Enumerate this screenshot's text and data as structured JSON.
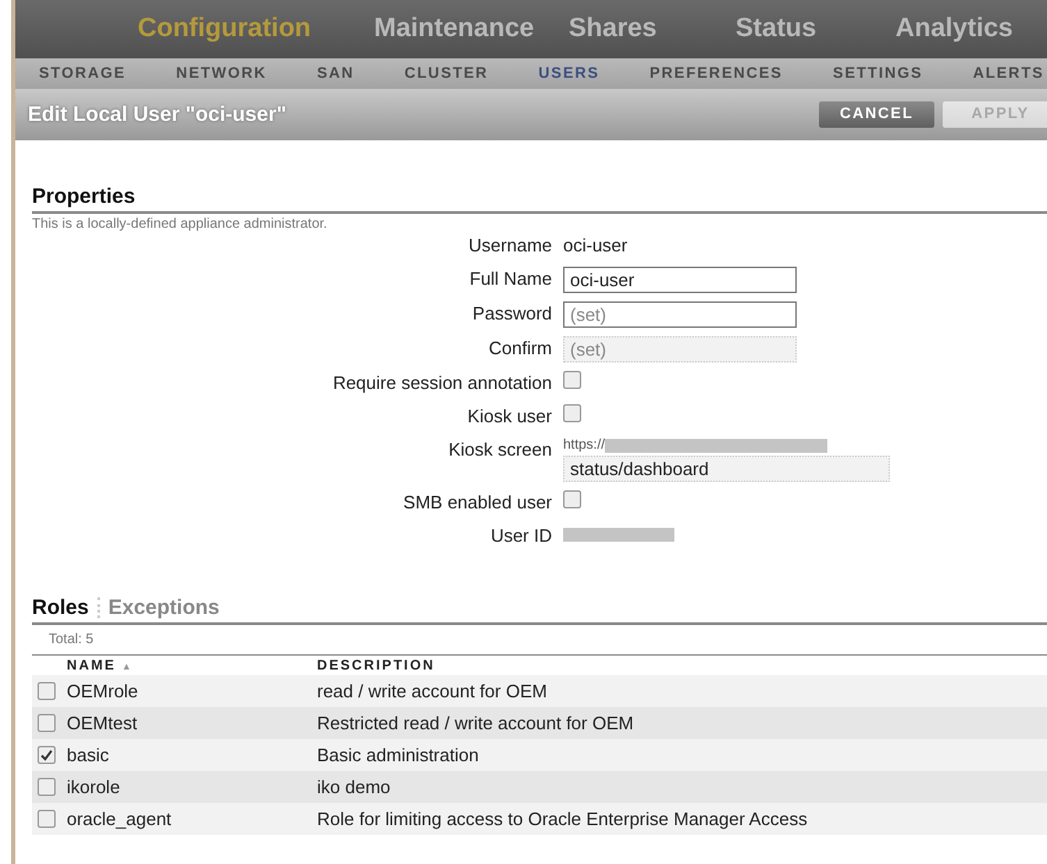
{
  "main_tabs": [
    {
      "label": "Configuration",
      "selected": true
    },
    {
      "label": "Maintenance",
      "selected": false
    },
    {
      "label": "Shares",
      "selected": false
    },
    {
      "label": "Status",
      "selected": false
    },
    {
      "label": "Analytics",
      "selected": false
    }
  ],
  "sub_tabs": [
    {
      "label": "STORAGE",
      "selected": false
    },
    {
      "label": "NETWORK",
      "selected": false
    },
    {
      "label": "SAN",
      "selected": false
    },
    {
      "label": "CLUSTER",
      "selected": false
    },
    {
      "label": "USERS",
      "selected": true
    },
    {
      "label": "PREFERENCES",
      "selected": false
    },
    {
      "label": "SETTINGS",
      "selected": false
    },
    {
      "label": "ALERTS",
      "selected": false
    }
  ],
  "header": {
    "title": "Edit Local User \"oci-user\"",
    "buttons": [
      {
        "label": "CANCEL",
        "disabled": false
      },
      {
        "label": "APPLY",
        "disabled": true
      }
    ]
  },
  "properties": {
    "title": "Properties",
    "description": "This is a locally-defined appliance administrator.",
    "fields": [
      {
        "kind": "text",
        "label": "Username",
        "value": "oci-user"
      },
      {
        "kind": "input",
        "label": "Full Name",
        "value": "oci-user"
      },
      {
        "kind": "input",
        "label": "Password",
        "placeholder": "(set)"
      },
      {
        "kind": "readonly",
        "label": "Confirm",
        "placeholder": "(set)"
      },
      {
        "kind": "checkbox",
        "label": "Require session annotation",
        "checked": false
      },
      {
        "kind": "checkbox",
        "label": "Kiosk user",
        "checked": false
      },
      {
        "kind": "kiosk",
        "label": "Kiosk screen",
        "prefix": "https://",
        "value": "status/dashboard"
      },
      {
        "kind": "checkbox",
        "label": "SMB enabled user",
        "checked": false
      },
      {
        "kind": "redacted",
        "label": "User ID"
      }
    ]
  },
  "roles": {
    "tabs": [
      {
        "label": "Roles",
        "selected": true
      },
      {
        "label": "Exceptions",
        "selected": false
      }
    ],
    "total": "Total: 5",
    "columns": [
      {
        "label": "NAME",
        "sort": "▲"
      },
      {
        "label": "DESCRIPTION"
      }
    ],
    "rows": [
      {
        "name": "OEMrole",
        "description": "read / write account for OEM",
        "checked": false
      },
      {
        "name": "OEMtest",
        "description": "Restricted read / write account for OEM",
        "checked": false
      },
      {
        "name": "basic",
        "description": "Basic administration",
        "checked": true
      },
      {
        "name": "ikorole",
        "description": "iko demo",
        "checked": false
      },
      {
        "name": "oracle_agent",
        "description": "Role for limiting access to Oracle Enterprise Manager Access",
        "checked": false
      }
    ]
  }
}
